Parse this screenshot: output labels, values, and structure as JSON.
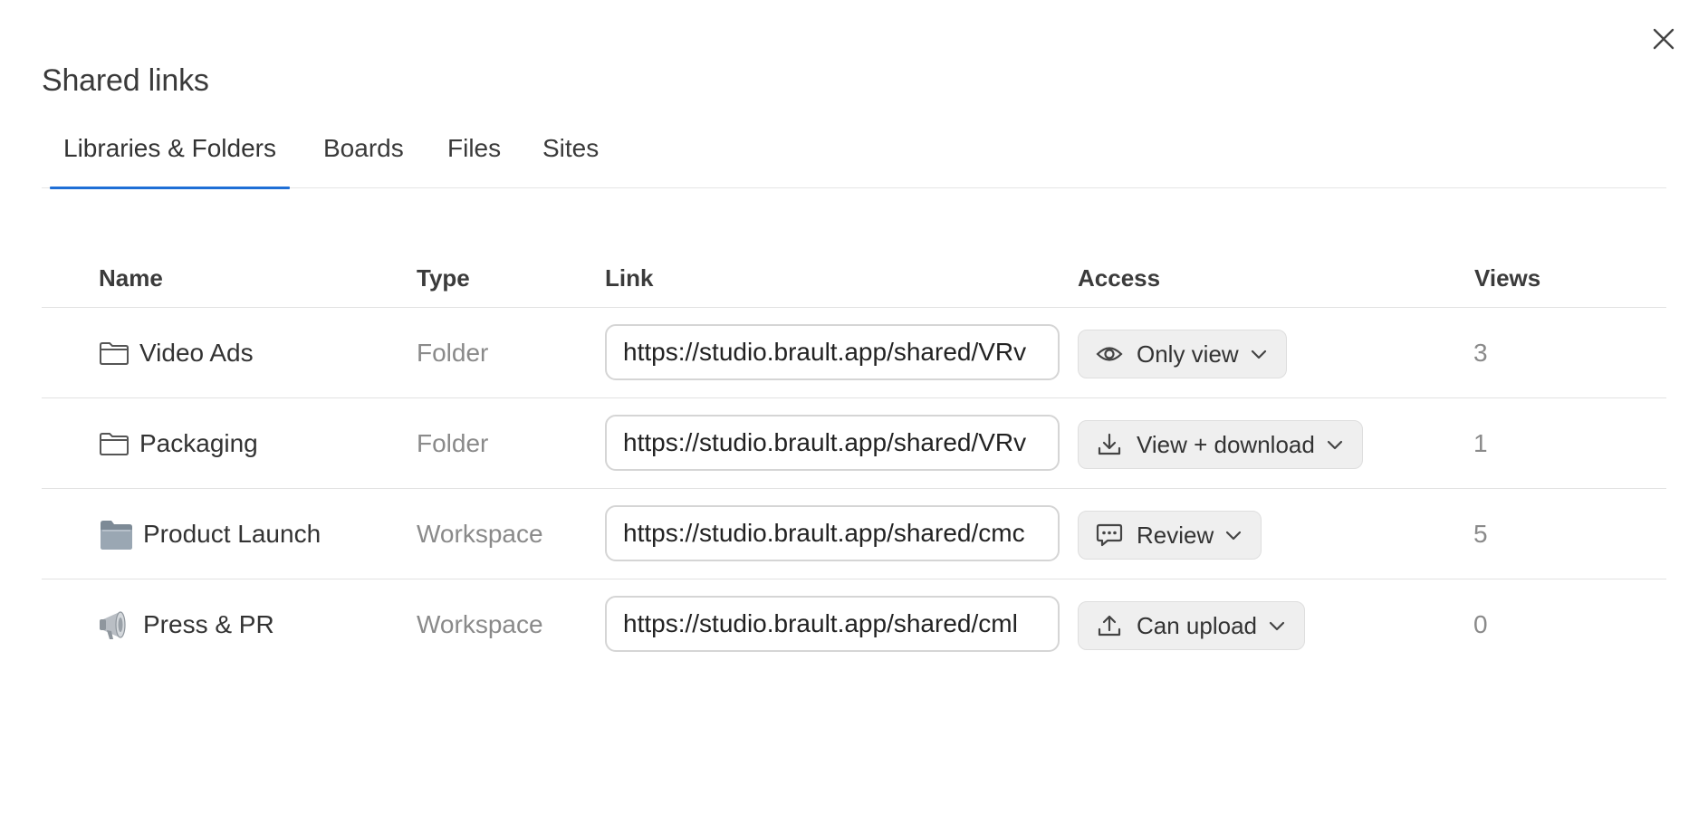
{
  "dialog": {
    "title": "Shared links",
    "close_icon": "close-icon"
  },
  "tabs": [
    {
      "label": "Libraries & Folders",
      "active": true
    },
    {
      "label": "Boards",
      "active": false
    },
    {
      "label": "Files",
      "active": false
    },
    {
      "label": "Sites",
      "active": false
    }
  ],
  "table": {
    "headers": {
      "name": "Name",
      "type": "Type",
      "link": "Link",
      "access": "Access",
      "views": "Views"
    },
    "rows": [
      {
        "icon": "folder-icon",
        "name": "Video Ads",
        "type": "Folder",
        "link": "https://studio.brault.app/shared/VRv",
        "access_icon": "eye-icon",
        "access": "Only view",
        "views": "3"
      },
      {
        "icon": "folder-icon",
        "name": "Packaging",
        "type": "Folder",
        "link": "https://studio.brault.app/shared/VRv",
        "access_icon": "download-icon",
        "access": "View + download",
        "views": "1"
      },
      {
        "icon": "workspace-folder-icon",
        "name": "Product Launch",
        "type": "Workspace",
        "link": "https://studio.brault.app/shared/cmc",
        "access_icon": "comment-icon",
        "access": "Review",
        "views": "5"
      },
      {
        "icon": "megaphone-icon",
        "name": "Press & PR",
        "type": "Workspace",
        "link": "https://studio.brault.app/shared/cml",
        "access_icon": "upload-icon",
        "access": "Can upload",
        "views": "0"
      }
    ]
  },
  "colors": {
    "accent": "#1f6fd6",
    "muted_text": "#8a8a8a",
    "chip_bg": "#efefef"
  }
}
